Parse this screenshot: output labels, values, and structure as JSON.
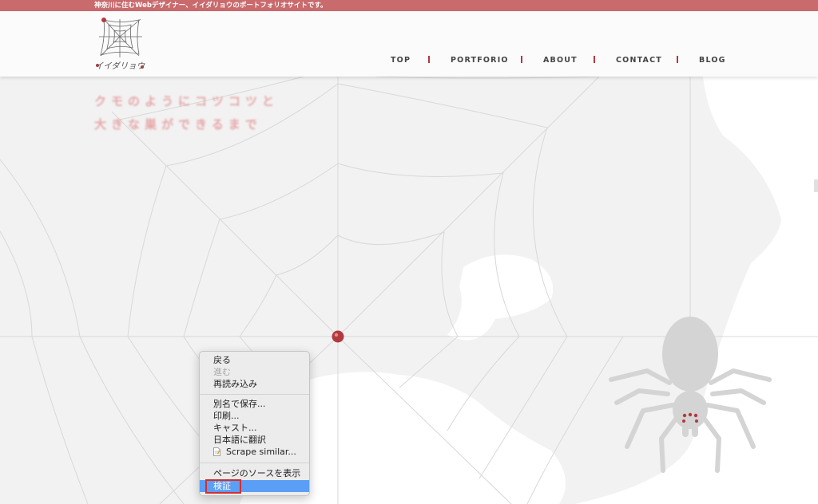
{
  "top_banner": {
    "text": "神奈川に住むWebデザイナー、イイダリョウのポートフォリオサイトです。"
  },
  "logo": {
    "text": "イイダリョウ"
  },
  "nav": {
    "items": [
      {
        "label": "TOP"
      },
      {
        "label": "PORTFORIO"
      },
      {
        "label": "ABOUT"
      },
      {
        "label": "CONTACT"
      },
      {
        "label": "BLOG"
      }
    ]
  },
  "hero": {
    "line1": "クモのようにコツコツと",
    "line2": "大きな巣ができるまで"
  },
  "context_menu": {
    "items": [
      {
        "label": "戻る",
        "state": "normal"
      },
      {
        "label": "進む",
        "state": "disabled"
      },
      {
        "label": "再読み込み",
        "state": "normal"
      },
      {
        "label": "別名で保存...",
        "state": "normal"
      },
      {
        "label": "印刷...",
        "state": "normal"
      },
      {
        "label": "キャスト...",
        "state": "normal"
      },
      {
        "label": "日本語に翻訳",
        "state": "normal"
      },
      {
        "label": "Scrape similar...",
        "state": "normal",
        "icon": "document-icon"
      },
      {
        "label": "ページのソースを表示",
        "state": "normal"
      },
      {
        "label": "検証",
        "state": "selected",
        "highlighted": true
      }
    ]
  },
  "colors": {
    "accent": "#c96a6d",
    "nav_separator": "#b13a3f",
    "menu_selected": "#5b9ef6",
    "highlight_box": "#d62d2d",
    "spider": "#d4d4d4"
  }
}
